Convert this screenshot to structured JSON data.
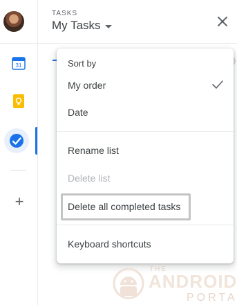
{
  "header": {
    "eyebrow": "TASKS",
    "list_name": "My Tasks"
  },
  "rail": {
    "calendar_day": "31"
  },
  "menu": {
    "section_label": "Sort by",
    "sort_options": [
      {
        "label": "My order",
        "selected": true
      },
      {
        "label": "Date",
        "selected": false
      }
    ],
    "list_actions": [
      {
        "label": "Rename list",
        "enabled": true
      },
      {
        "label": "Delete list",
        "enabled": false
      },
      {
        "label": "Delete all completed tasks",
        "enabled": true,
        "highlighted": true
      }
    ],
    "extra": [
      {
        "label": "Keyboard shortcuts",
        "enabled": true
      }
    ]
  },
  "watermark": {
    "line1": "THE",
    "line2": "ANDROID",
    "line3": "PORTAL"
  },
  "colors": {
    "accent_blue": "#1a73e8",
    "keep_yellow": "#fbbc04",
    "disabled_text": "#b1b4b8"
  }
}
